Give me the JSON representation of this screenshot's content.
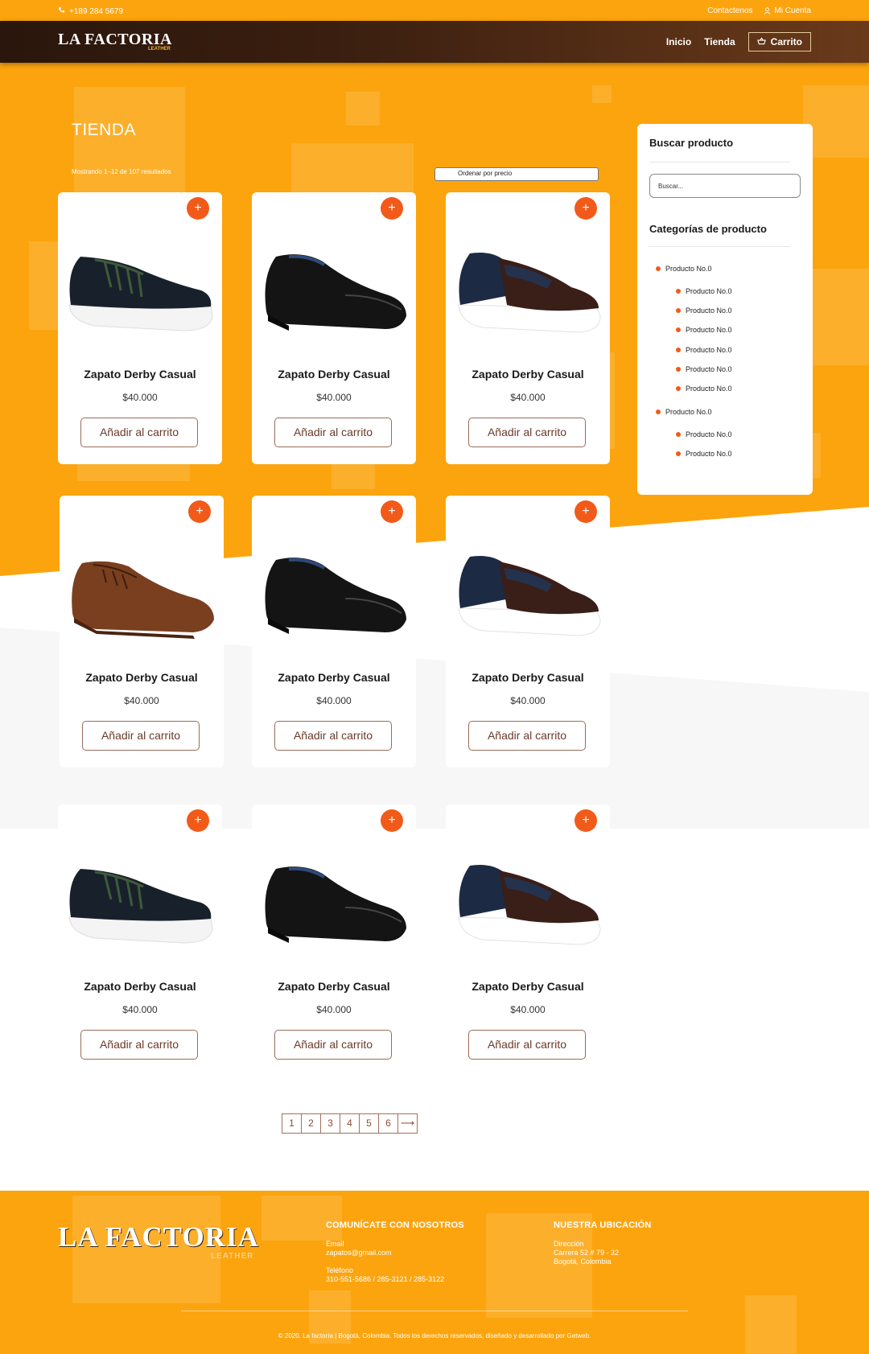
{
  "topbar": {
    "phone": "+189 284 5679",
    "contact": "Contactenos",
    "account": "Mi Cuenta"
  },
  "header": {
    "logo_text": "LA FACTORIA",
    "logo_sub": "LEATHER",
    "nav": {
      "home": "Inicio",
      "shop": "Tienda",
      "cart": "Carrito"
    }
  },
  "shop": {
    "title": "TIENDA",
    "results": "Mostrando 1–12 de 107 resultados",
    "sort_label": "Ordenar por precio"
  },
  "products": [
    {
      "name": "Zapato Derby Casual",
      "price": "$40.000",
      "cta": "Añadir al carrito",
      "plus": "+",
      "image": "sneaker-black"
    },
    {
      "name": "Zapato Derby Casual",
      "price": "$40.000",
      "cta": "Añadir al carrito",
      "plus": "+",
      "image": "loafer-black"
    },
    {
      "name": "Zapato Derby Casual",
      "price": "$40.000",
      "cta": "Añadir al carrito",
      "plus": "+",
      "image": "loafer-brown-navy"
    },
    {
      "name": "Zapato Derby Casual",
      "price": "$40.000",
      "cta": "Añadir al carrito",
      "plus": "+",
      "image": "derby-brown"
    },
    {
      "name": "Zapato Derby Casual",
      "price": "$40.000",
      "cta": "Añadir al carrito",
      "plus": "+",
      "image": "loafer-black"
    },
    {
      "name": "Zapato Derby Casual",
      "price": "$40.000",
      "cta": "Añadir al carrito",
      "plus": "+",
      "image": "loafer-brown-navy"
    },
    {
      "name": "Zapato Derby Casual",
      "price": "$40.000",
      "cta": "Añadir al carrito",
      "plus": "+",
      "image": "sneaker-black"
    },
    {
      "name": "Zapato Derby Casual",
      "price": "$40.000",
      "cta": "Añadir al carrito",
      "plus": "+",
      "image": "loafer-black"
    },
    {
      "name": "Zapato Derby Casual",
      "price": "$40.000",
      "cta": "Añadir al carrito",
      "plus": "+",
      "image": "loafer-brown-navy"
    }
  ],
  "sidebar": {
    "search_title": "Buscar producto",
    "search_placeholder": "Buscar...",
    "categories_title": "Categorías de producto",
    "categories": [
      {
        "label": "Producto No.0",
        "children": [
          "Producto No.0",
          "Producto No.0",
          "Producto No.0",
          "Producto No.0",
          "Producto No.0",
          "Producto No.0"
        ]
      },
      {
        "label": "Producto No.0",
        "children": [
          "Producto No.0",
          "Producto No.0"
        ]
      }
    ]
  },
  "pagination": {
    "pages": [
      "1",
      "2",
      "3",
      "4",
      "5",
      "6"
    ],
    "next": "⟶"
  },
  "footer": {
    "logo_text": "LA FACTORIA",
    "logo_sub": "LEATHER",
    "contact": {
      "title": "COMUNÍCATE CON NOSOTROS",
      "email_label": "Email",
      "email": "zapatos@gmail.com",
      "phone_label": "Teléfono",
      "phone": "310-551-5686 / 285-3121 / 285-3122"
    },
    "location": {
      "title": "NUESTRA UBICACIÓN",
      "label": "Dirección",
      "line1": "Carrera 52 # 79 - 32",
      "line2": "Bogotá, Colombia"
    },
    "copyright": "© 2020, La factoría | Bogotá, Colombia. Todos los derechos reservados, diseñado y desarrollado por Getweb."
  },
  "colors": {
    "orange": "#FCA40E",
    "accent": "#F25A1A",
    "brown": "#3b1f10"
  }
}
